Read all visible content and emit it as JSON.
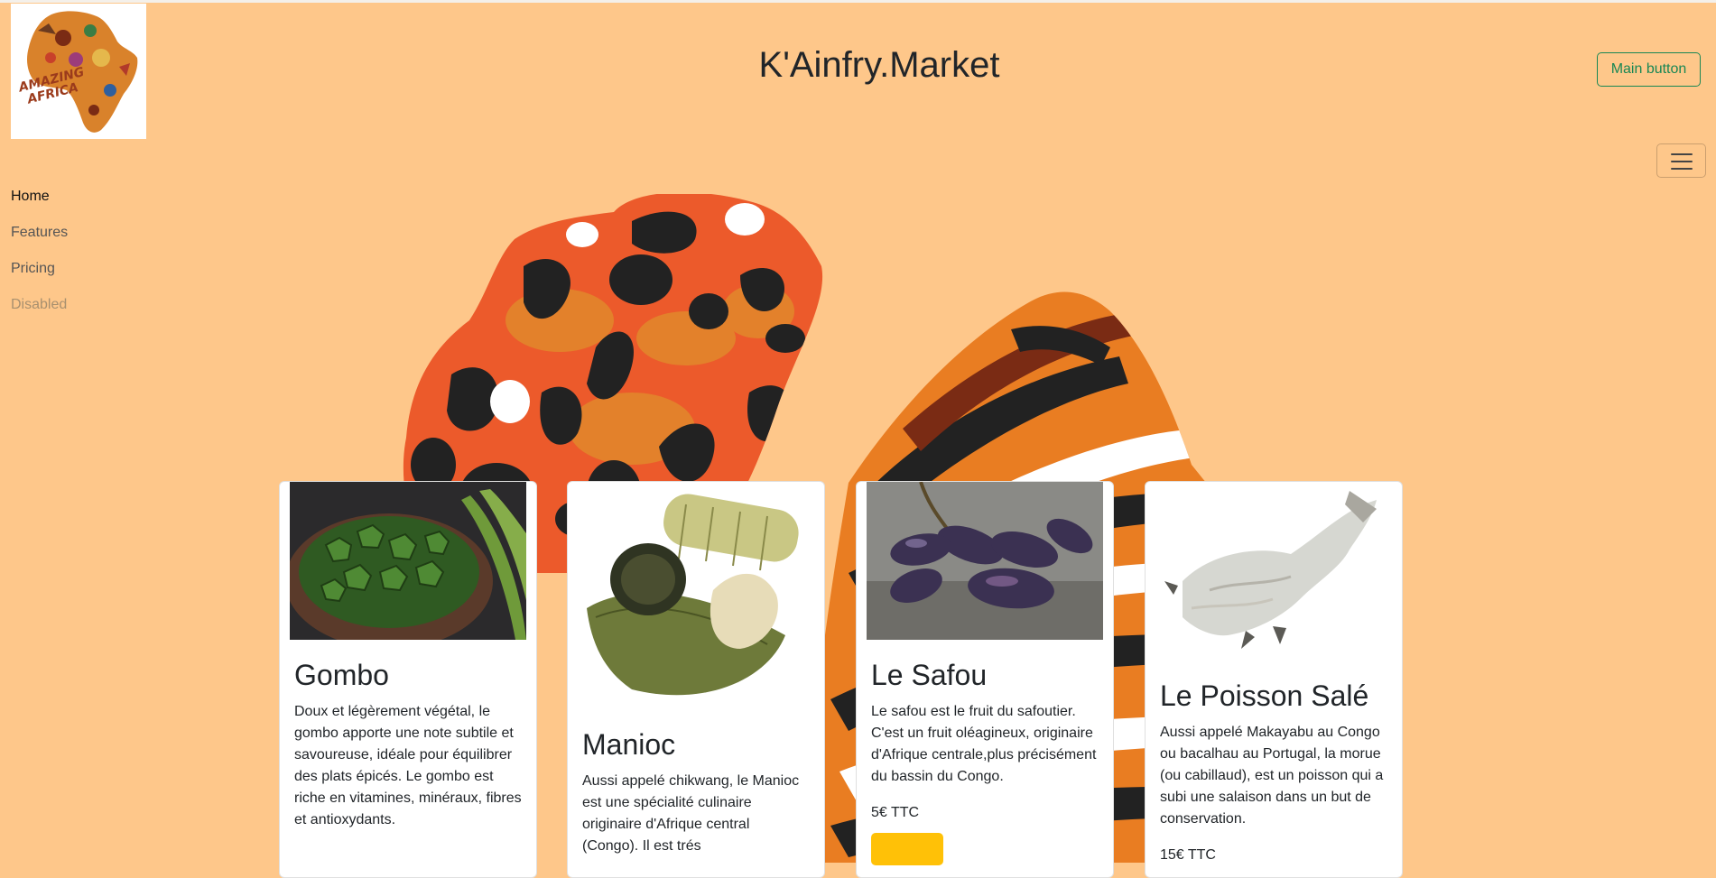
{
  "header": {
    "logo_text": "AMAZING AFRICA",
    "title": "K'Ainfry.Market",
    "main_button": "Main button"
  },
  "nav": {
    "items": [
      {
        "label": "Home",
        "state": "active"
      },
      {
        "label": "Features",
        "state": "normal"
      },
      {
        "label": "Pricing",
        "state": "normal"
      },
      {
        "label": "Disabled",
        "state": "disabled"
      }
    ]
  },
  "products": [
    {
      "title": "Gombo",
      "text": "Doux et légèrement végétal, le gombo apporte une note subtile et savoureuse, idéale pour équilibrer des plats épicés. Le gombo est riche en vitamines, minéraux, fibres et antioxydants.",
      "price": ""
    },
    {
      "title": "Manioc",
      "text": "Aussi appelé chikwang, le Manioc est une spécialité culinaire originaire d'Afrique central (Congo). Il est trés",
      "price": ""
    },
    {
      "title": "Le Safou",
      "text": "Le safou est le fruit du safoutier. C'est un fruit oléagineux, originaire d'Afrique centrale,plus précisément du bassin du Congo.",
      "price": "5€ TTC"
    },
    {
      "title": "Le Poisson Salé",
      "text": "Aussi appelé Makayabu au Congo ou bacalhau au Portugal, la morue (ou cabillaud), est un poisson qui a subi une salaison dans un but de conservation.",
      "price": "15€ TTC"
    }
  ],
  "colors": {
    "background": "#fec78a",
    "accent_green": "#198754",
    "buy_button": "#ffc107",
    "leopard_orange": "#ec5a2b",
    "tiger_orange": "#e97d22",
    "pattern_dark": "#222222"
  }
}
